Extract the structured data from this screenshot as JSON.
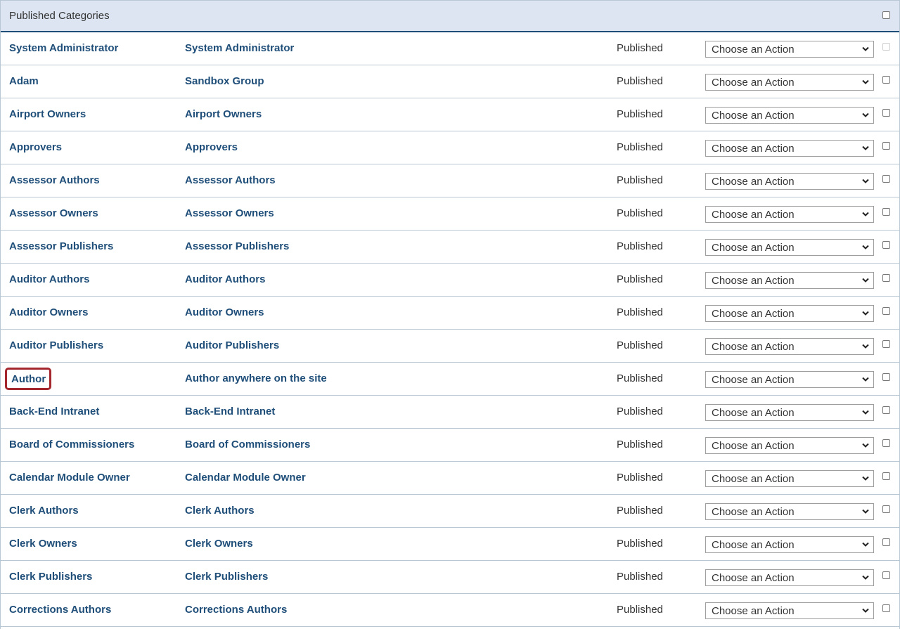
{
  "panel": {
    "title": "Published Categories"
  },
  "select_placeholder": "Choose an Action",
  "rows": [
    {
      "name": "System Administrator",
      "description": "System Administrator",
      "status": "Published",
      "checkbox_disabled": true
    },
    {
      "name": "Adam",
      "description": "Sandbox Group",
      "status": "Published"
    },
    {
      "name": "Airport Owners",
      "description": "Airport Owners",
      "status": "Published"
    },
    {
      "name": "Approvers",
      "description": "Approvers",
      "status": "Published"
    },
    {
      "name": "Assessor Authors",
      "description": "Assessor Authors",
      "status": "Published"
    },
    {
      "name": "Assessor Owners",
      "description": "Assessor Owners",
      "status": "Published"
    },
    {
      "name": "Assessor Publishers",
      "description": "Assessor Publishers",
      "status": "Published"
    },
    {
      "name": "Auditor Authors",
      "description": "Auditor Authors",
      "status": "Published"
    },
    {
      "name": "Auditor Owners",
      "description": "Auditor Owners",
      "status": "Published"
    },
    {
      "name": "Auditor Publishers",
      "description": "Auditor Publishers",
      "status": "Published"
    },
    {
      "name": "Author",
      "description": "Author anywhere on the site",
      "status": "Published",
      "highlighted": true
    },
    {
      "name": "Back-End Intranet",
      "description": "Back-End Intranet",
      "status": "Published"
    },
    {
      "name": "Board of Commissioners",
      "description": "Board of Commissioners",
      "status": "Published"
    },
    {
      "name": "Calendar Module Owner",
      "description": "Calendar Module Owner",
      "status": "Published"
    },
    {
      "name": "Clerk Authors",
      "description": "Clerk Authors",
      "status": "Published"
    },
    {
      "name": "Clerk Owners",
      "description": "Clerk Owners",
      "status": "Published"
    },
    {
      "name": "Clerk Publishers",
      "description": "Clerk Publishers",
      "status": "Published"
    },
    {
      "name": "Corrections Authors",
      "description": "Corrections Authors",
      "status": "Published"
    }
  ],
  "colors": {
    "header_bg": "#dce5f1",
    "link": "#1f4e79",
    "highlight_border": "#a3272c",
    "row_border": "#b9c6d3"
  }
}
